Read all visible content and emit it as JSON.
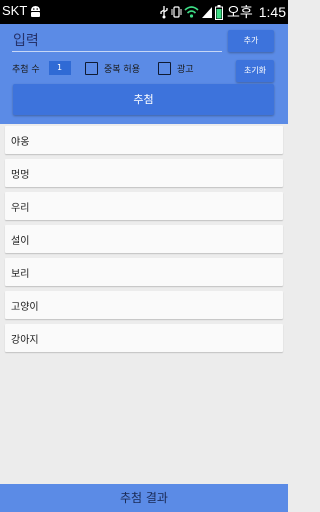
{
  "statusbar": {
    "carrier": "SKT",
    "time_label": "오후",
    "time": "1:45",
    "icons": [
      "android-robot-icon",
      "usb-icon",
      "vibrate-icon",
      "wifi-icon",
      "signal-icon",
      "battery-icon"
    ]
  },
  "input": {
    "placeholder": "입력"
  },
  "buttons": {
    "add": "추가",
    "reset": "초기화",
    "recommend": "추첨",
    "results": "추첨 결과"
  },
  "count": {
    "label": "추첨 수",
    "value": "1"
  },
  "checkboxes": [
    {
      "label": "중복 허용",
      "checked": false
    },
    {
      "label": "광고",
      "checked": false
    }
  ],
  "list": [
    "야옹",
    "멍멍",
    "우리",
    "설이",
    "보리",
    "고양이",
    "강아지"
  ],
  "colors": {
    "panel": "#5b8be6",
    "button": "#3d73dc",
    "count_box": "#2f6ad5",
    "background": "#ececec",
    "statusbar": "#000000"
  }
}
